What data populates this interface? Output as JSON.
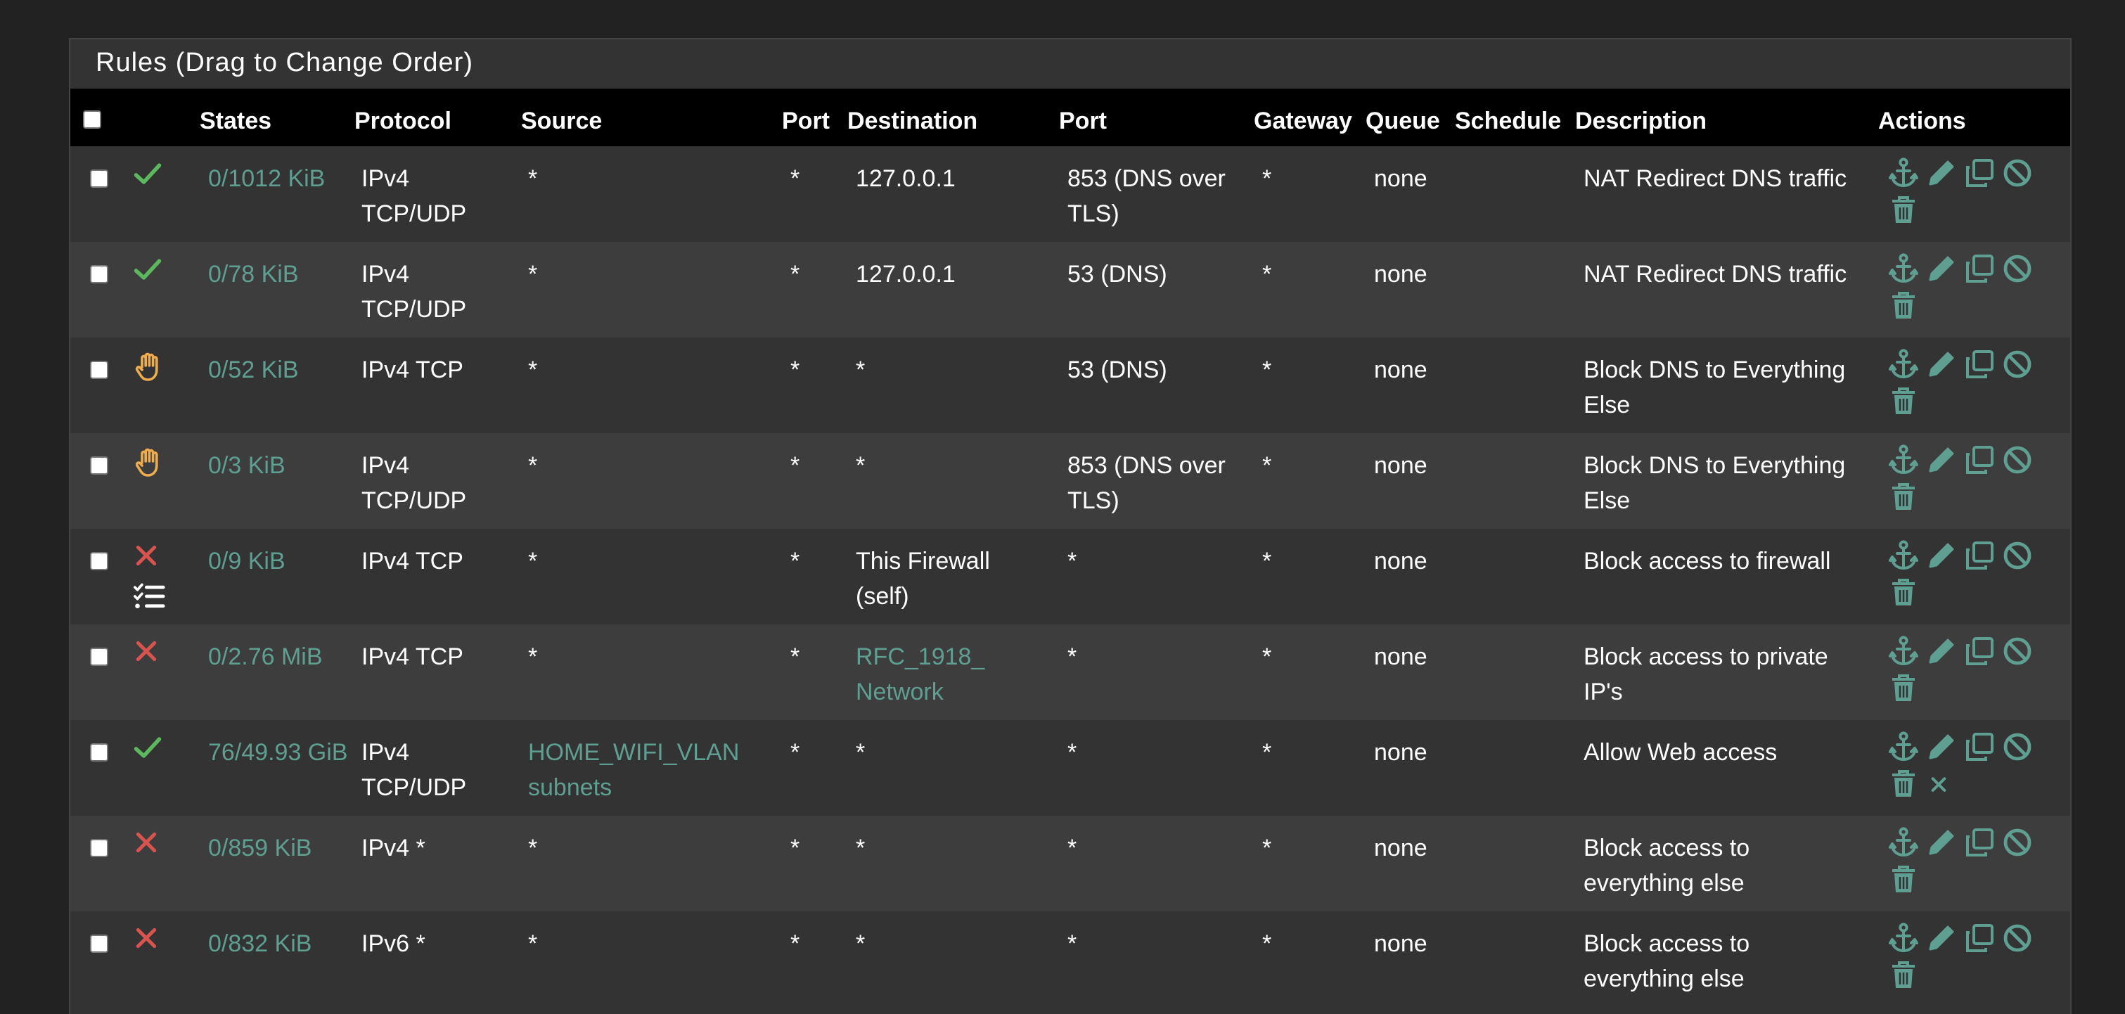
{
  "panel": {
    "title": "Rules (Drag to Change Order)"
  },
  "columns": {
    "states": "States",
    "protocol": "Protocol",
    "source": "Source",
    "source_port": "Port",
    "destination": "Destination",
    "destination_port": "Port",
    "gateway": "Gateway",
    "queue": "Queue",
    "schedule": "Schedule",
    "description": "Description",
    "actions": "Actions"
  },
  "colors": {
    "pass": "#5cb85c",
    "block": "#d9534f",
    "reject_hand": "#f0ad4e",
    "link": "#5f9f92",
    "action_icon": "#5f9f92"
  },
  "rows": [
    {
      "status_icon": "check-icon",
      "extra_icon": "",
      "states": "0/1012 KiB",
      "protocol_l1": "IPv4",
      "protocol_l2": "TCP/UDP",
      "source": "*",
      "source_link": false,
      "source_port": "*",
      "destination": "127.0.0.1",
      "destination_l2": "",
      "destination_link": false,
      "destination_port_l1": "853 (DNS over",
      "destination_port_l2": "TLS)",
      "gateway": "*",
      "queue": "none",
      "schedule": "",
      "description_l1": "NAT Redirect DNS traffic",
      "description_l2": "",
      "extra_action": false
    },
    {
      "status_icon": "check-icon",
      "extra_icon": "",
      "states": "0/78 KiB",
      "protocol_l1": "IPv4",
      "protocol_l2": "TCP/UDP",
      "source": "*",
      "source_link": false,
      "source_port": "*",
      "destination": "127.0.0.1",
      "destination_l2": "",
      "destination_link": false,
      "destination_port_l1": "53 (DNS)",
      "destination_port_l2": "",
      "gateway": "*",
      "queue": "none",
      "schedule": "",
      "description_l1": "NAT Redirect DNS traffic",
      "description_l2": "",
      "extra_action": false
    },
    {
      "status_icon": "hand-icon",
      "extra_icon": "",
      "states": "0/52 KiB",
      "protocol_l1": "IPv4 TCP",
      "protocol_l2": "",
      "source": "*",
      "source_link": false,
      "source_port": "*",
      "destination": "*",
      "destination_l2": "",
      "destination_link": false,
      "destination_port_l1": "53 (DNS)",
      "destination_port_l2": "",
      "gateway": "*",
      "queue": "none",
      "schedule": "",
      "description_l1": "Block DNS to Everything",
      "description_l2": "Else",
      "extra_action": false
    },
    {
      "status_icon": "hand-icon",
      "extra_icon": "",
      "states": "0/3 KiB",
      "protocol_l1": "IPv4",
      "protocol_l2": "TCP/UDP",
      "source": "*",
      "source_link": false,
      "source_port": "*",
      "destination": "*",
      "destination_l2": "",
      "destination_link": false,
      "destination_port_l1": "853 (DNS over",
      "destination_port_l2": "TLS)",
      "gateway": "*",
      "queue": "none",
      "schedule": "",
      "description_l1": "Block DNS to Everything",
      "description_l2": "Else",
      "extra_action": false
    },
    {
      "status_icon": "x-icon",
      "extra_icon": "list-check-icon",
      "states": "0/9 KiB",
      "protocol_l1": "IPv4 TCP",
      "protocol_l2": "",
      "source": "*",
      "source_link": false,
      "source_port": "*",
      "destination": "This Firewall",
      "destination_l2": "(self)",
      "destination_link": false,
      "destination_port_l1": "*",
      "destination_port_l2": "",
      "gateway": "*",
      "queue": "none",
      "schedule": "",
      "description_l1": "Block access to firewall",
      "description_l2": "",
      "extra_action": false
    },
    {
      "status_icon": "x-icon",
      "extra_icon": "",
      "states": "0/2.76 MiB",
      "protocol_l1": "IPv4 TCP",
      "protocol_l2": "",
      "source": "*",
      "source_link": false,
      "source_port": "*",
      "destination": "RFC_1918_",
      "destination_l2": "Network",
      "destination_link": true,
      "destination_port_l1": "*",
      "destination_port_l2": "",
      "gateway": "*",
      "queue": "none",
      "schedule": "",
      "description_l1": "Block access to private",
      "description_l2": "IP's",
      "extra_action": false
    },
    {
      "status_icon": "check-icon",
      "extra_icon": "",
      "states": "76/49.93 GiB",
      "protocol_l1": "IPv4",
      "protocol_l2": "TCP/UDP",
      "source": "HOME_WIFI_VLAN",
      "source_l2": "subnets",
      "source_link": true,
      "source_port": "*",
      "destination": "*",
      "destination_l2": "",
      "destination_link": false,
      "destination_port_l1": "*",
      "destination_port_l2": "",
      "gateway": "*",
      "queue": "none",
      "schedule": "",
      "description_l1": "Allow Web access",
      "description_l2": "",
      "extra_action": true
    },
    {
      "status_icon": "x-icon",
      "extra_icon": "",
      "states": "0/859 KiB",
      "protocol_l1": "IPv4 *",
      "protocol_l2": "",
      "source": "*",
      "source_link": false,
      "source_port": "*",
      "destination": "*",
      "destination_l2": "",
      "destination_link": false,
      "destination_port_l1": "*",
      "destination_port_l2": "",
      "gateway": "*",
      "queue": "none",
      "schedule": "",
      "description_l1": "Block access to",
      "description_l2": "everything else",
      "extra_action": false
    },
    {
      "status_icon": "x-icon",
      "extra_icon": "",
      "states": "0/832 KiB",
      "protocol_l1": "IPv6 *",
      "protocol_l2": "",
      "source": "*",
      "source_link": false,
      "source_port": "*",
      "destination": "*",
      "destination_l2": "",
      "destination_link": false,
      "destination_port_l1": "*",
      "destination_port_l2": "",
      "gateway": "*",
      "queue": "none",
      "schedule": "",
      "description_l1": "Block access to",
      "description_l2": "everything else",
      "extra_action": false
    }
  ]
}
